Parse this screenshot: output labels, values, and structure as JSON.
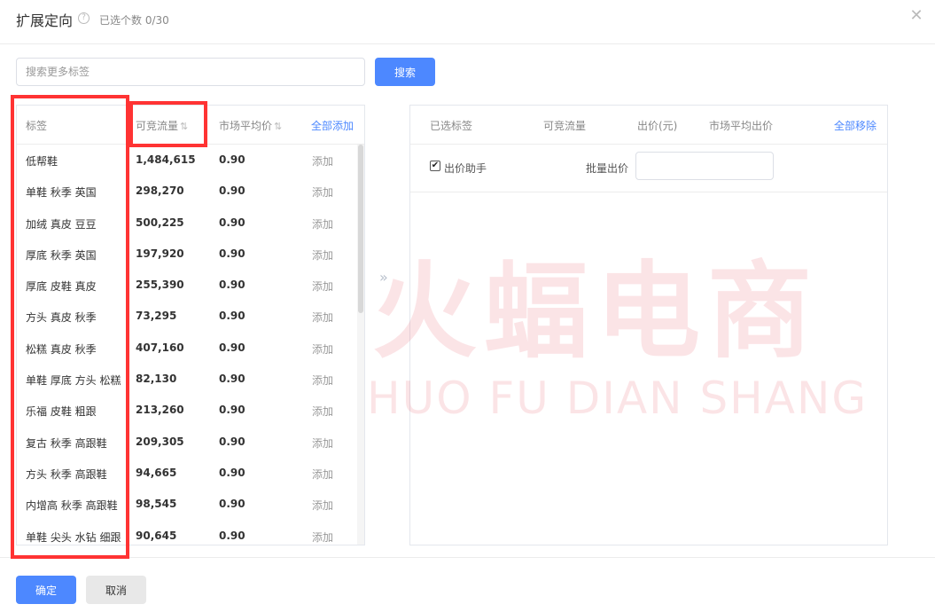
{
  "header": {
    "title": "扩展定向",
    "help_icon": "?",
    "count_text": "已选个数 0/30",
    "close_icon": "✕"
  },
  "search": {
    "placeholder": "搜索更多标签",
    "button_label": "搜索"
  },
  "left_table": {
    "columns": {
      "tag": "标签",
      "traffic": "可竞流量",
      "avg_price": "市场平均价",
      "add_all": "全部添加"
    },
    "sort_icon": "⇅",
    "rows": [
      {
        "tag": "低帮鞋",
        "traffic": "1,484,615",
        "price": "0.90",
        "action": "添加"
      },
      {
        "tag": "单鞋 秋季 英国",
        "traffic": "298,270",
        "price": "0.90",
        "action": "添加"
      },
      {
        "tag": "加绒 真皮 豆豆",
        "traffic": "500,225",
        "price": "0.90",
        "action": "添加"
      },
      {
        "tag": "厚底 秋季 英国",
        "traffic": "197,920",
        "price": "0.90",
        "action": "添加"
      },
      {
        "tag": "厚底 皮鞋 真皮",
        "traffic": "255,390",
        "price": "0.90",
        "action": "添加"
      },
      {
        "tag": "方头 真皮 秋季",
        "traffic": "73,295",
        "price": "0.90",
        "action": "添加"
      },
      {
        "tag": "松糕 真皮 秋季",
        "traffic": "407,160",
        "price": "0.90",
        "action": "添加"
      },
      {
        "tag": "单鞋 厚底 方头 松糕",
        "traffic": "82,130",
        "price": "0.90",
        "action": "添加"
      },
      {
        "tag": "乐福 皮鞋 粗跟",
        "traffic": "213,260",
        "price": "0.90",
        "action": "添加"
      },
      {
        "tag": "复古 秋季 高跟鞋",
        "traffic": "209,305",
        "price": "0.90",
        "action": "添加"
      },
      {
        "tag": "方头 秋季 高跟鞋",
        "traffic": "94,665",
        "price": "0.90",
        "action": "添加"
      },
      {
        "tag": "内增高 秋季 高跟鞋",
        "traffic": "98,545",
        "price": "0.90",
        "action": "添加"
      },
      {
        "tag": "单鞋 尖头 水钻 细跟",
        "traffic": "90,645",
        "price": "0.90",
        "action": "添加"
      }
    ]
  },
  "transfer_icon": "»",
  "right_table": {
    "columns": {
      "selected_tag": "已选标签",
      "traffic": "可竞流量",
      "bid": "出价(元)",
      "market_bid": "市场平均出价",
      "remove_all": "全部移除"
    },
    "checkbox_mark": "✔",
    "assist_label": "出价助手",
    "batch_label": "批量出价",
    "batch_value": ""
  },
  "footer": {
    "confirm_label": "确定",
    "cancel_label": "取消"
  },
  "watermark": {
    "cn_text": "火蝠电商",
    "en_text": "HUO FU DIAN SHANG"
  },
  "colors": {
    "primary": "#4d88ff",
    "highlight": "#ff3333",
    "watermark": "#e8344a"
  }
}
